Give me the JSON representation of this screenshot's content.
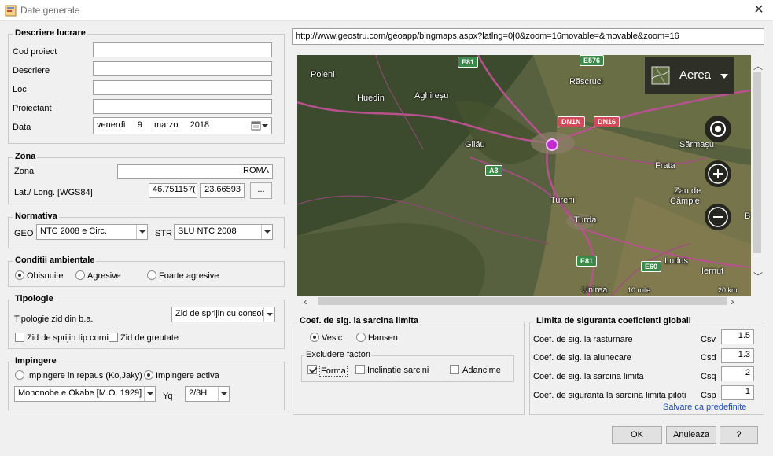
{
  "window": {
    "title": "Date generale",
    "close_icon": "close-icon"
  },
  "descriere": {
    "title": "Descriere lucrare",
    "cod_proiect_label": "Cod proiect",
    "cod_proiect_value": "",
    "descriere_label": "Descriere",
    "descriere_value": "",
    "loc_label": "Loc",
    "loc_value": "",
    "proiectant_label": "Proiectant",
    "proiectant_value": "",
    "data_label": "Data",
    "date_weekday": "venerdì",
    "date_day": "9",
    "date_month": "marzo",
    "date_year": "2018"
  },
  "zona": {
    "title": "Zona",
    "zona_label": "Zona",
    "zona_value": "ROMA",
    "latlong_label": "Lat./ Long. [WGS84]",
    "lat_value": "46.751157(",
    "long_value": "23.66593",
    "browse_label": "..."
  },
  "normativa": {
    "title": "Normativa",
    "geo_label": "GEO",
    "geo_value": "NTC 2008 e Circ.",
    "str_label": "STR",
    "str_value": "SLU NTC 2008"
  },
  "conditii": {
    "title": "Conditii ambientale",
    "options": [
      "Obisnuite",
      "Agresive",
      "Foarte agresive"
    ],
    "selected": "Obisnuite"
  },
  "tipologie": {
    "title": "Tipologie",
    "tip_label": "Tipologie zid din b.a.",
    "tip_value": "Zid de sprijin cu consola",
    "check1_label": "Zid de sprijin tip cornier",
    "check2_label": "Zid de greutate"
  },
  "impingere": {
    "title": "Impingere",
    "radio1_label": "Impingere in repaus (Ko,Jaky)",
    "radio2_label": "Impingere activa",
    "method_value": "Mononobe e Okabe [M.O. 1929]",
    "yq_label": "Yq",
    "yq_value": "2/3H"
  },
  "url_bar": {
    "value": "http://www.geostru.com/geoapp/bingmaps.aspx?latlng=0|0&zoom=16movable=&movable&zoom=16"
  },
  "map": {
    "layer_label": "Aerea",
    "scale_label": "10 mile",
    "scale_label2": "20 km",
    "places": [
      "Poieni",
      "Huedin",
      "Aghireșu",
      "Răscruci",
      "Gilău",
      "Sărmașu",
      "Frata",
      "Zau de",
      "Câmpie",
      "Tureni",
      "Turda",
      "Luduș",
      "Iernut",
      "Unirea",
      "B"
    ],
    "roads": [
      "E81",
      "E576",
      "DN1N",
      "DN16",
      "A3",
      "E81",
      "E60"
    ]
  },
  "coef_sarcina": {
    "title": "Coef. de sig. la sarcina limita",
    "radio1": "Vesic",
    "radio2": "Hansen",
    "excludere_title": "Excludere factori",
    "check_forma": "Forma",
    "check_inclinatie": "Inclinatie sarcini",
    "check_adancime": "Adancime"
  },
  "limita": {
    "title": "Limita de siguranta coeficienti globali",
    "rows": [
      {
        "label": "Coef. de sig. la rasturnare",
        "code": "Csv",
        "value": "1.5"
      },
      {
        "label": "Coef. de sig. la alunecare",
        "code": "Csd",
        "value": "1.3"
      },
      {
        "label": "Coef. de sig. la sarcina limita",
        "code": "Csq",
        "value": "2"
      },
      {
        "label": "Coef. de siguranta la sarcina limita piloti",
        "code": "Csp",
        "value": "1"
      }
    ],
    "save_link": "Salvare ca predefinite"
  },
  "buttons": {
    "ok": "OK",
    "cancel": "Anuleaza",
    "help": "?"
  }
}
